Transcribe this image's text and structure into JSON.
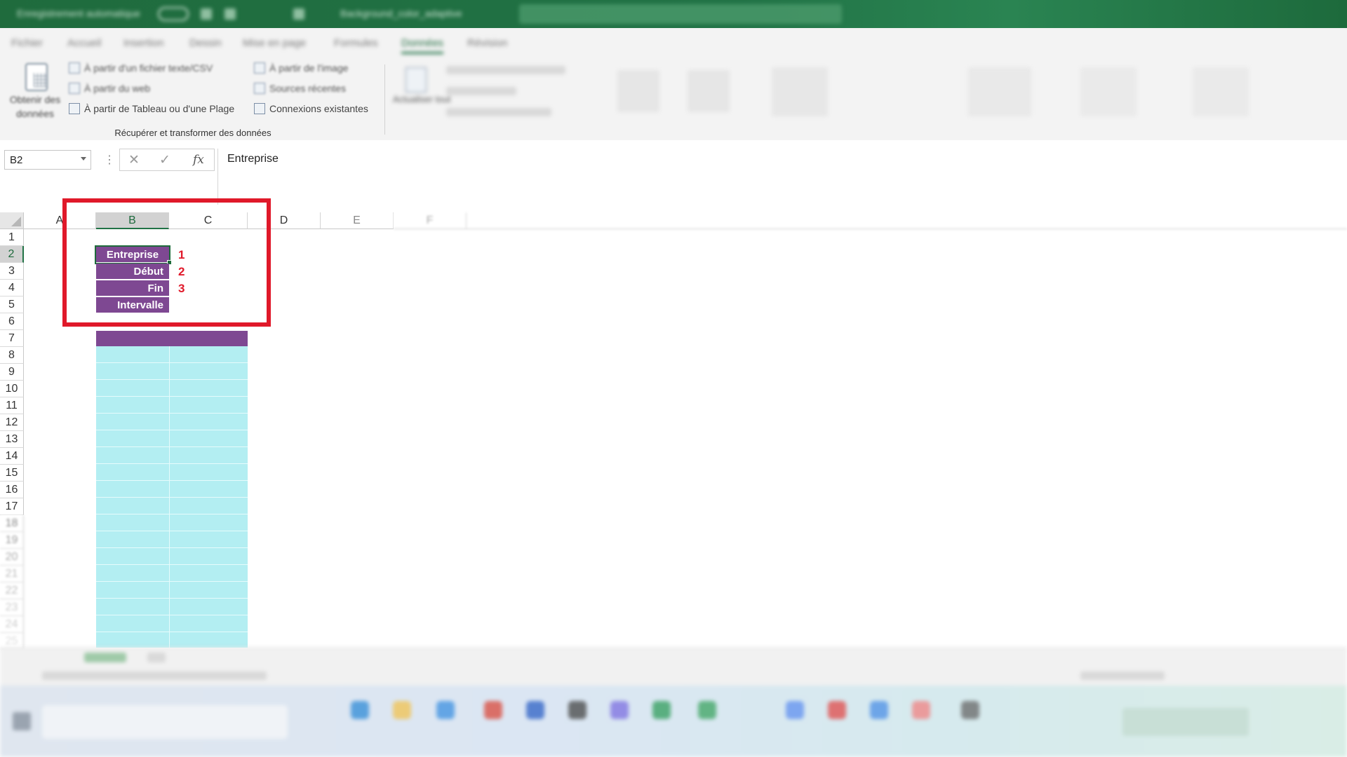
{
  "titlebar": {
    "autosave_label": "Enregistrement automatique",
    "file_name": "Background_color_adaptive"
  },
  "ribbon_tabs": [
    "Fichier",
    "Accueil",
    "Insertion",
    "Dessin",
    "Mise en page",
    "Formules",
    "Données",
    "Révision"
  ],
  "active_tab": "Données",
  "ribbon": {
    "get_data_label": "Obtenir des données",
    "from_text_csv": "À partir d'un fichier texte/CSV",
    "from_web": "À partir du web",
    "from_table": "À partir de Tableau ou d'une Plage",
    "from_image": "À partir de l'image",
    "recent_sources": "Sources récentes",
    "existing_connections": "Connexions existantes",
    "refresh_all": "Actualiser tout",
    "group_label": "Récupérer et transformer des données"
  },
  "formula_bar": {
    "name_box": "B2",
    "cancel_icon": "✕",
    "enter_icon": "✓",
    "fx_label": "fx",
    "value": "Entreprise"
  },
  "grid": {
    "columns": [
      "A",
      "B",
      "C",
      "D",
      "E",
      "F"
    ],
    "rows": [
      "1",
      "2",
      "3",
      "4",
      "5",
      "6",
      "7",
      "8",
      "9",
      "10",
      "11",
      "12",
      "13",
      "14",
      "15",
      "16",
      "17",
      "18",
      "19",
      "20",
      "21",
      "22",
      "23",
      "24",
      "25"
    ],
    "selected_column": "B",
    "selected_row": "2"
  },
  "cells": {
    "b2": "Entreprise",
    "b3": "Début",
    "b4": "Fin",
    "b5": "Intervalle"
  },
  "annotations": {
    "step1": "1",
    "step2": "2",
    "step3": "3"
  },
  "colors": {
    "excel_green": "#217346",
    "label_purple": "#7e4892",
    "table_cyan": "#b3eef2",
    "highlight_red": "#e0192a"
  }
}
